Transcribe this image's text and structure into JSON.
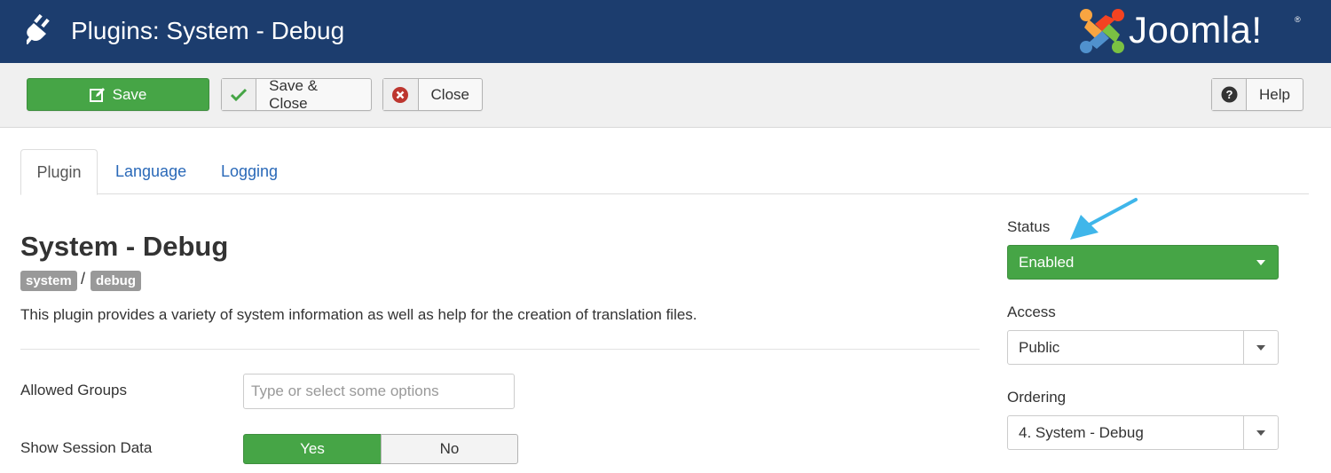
{
  "header": {
    "title": "Plugins: System - Debug",
    "logo_text": "Joomla!",
    "logo_mark": "®",
    "background": "#1c3d6e"
  },
  "toolbar": {
    "save_label": "Save",
    "save_close_label": "Save & Close",
    "close_label": "Close",
    "help_label": "Help",
    "save_color": "#46a546"
  },
  "tabs": [
    {
      "label": "Plugin",
      "active": true
    },
    {
      "label": "Language",
      "active": false
    },
    {
      "label": "Logging",
      "active": false
    }
  ],
  "plugin": {
    "title": "System - Debug",
    "badges": [
      "system",
      "debug"
    ],
    "separator": "/",
    "description": "This plugin provides a variety of system information as well as help for the creation of translation files."
  },
  "fields": {
    "allowed_groups": {
      "label": "Allowed Groups",
      "placeholder": "Type or select some options"
    },
    "show_session": {
      "label": "Show Session Data",
      "yes": "Yes",
      "no": "No",
      "selected": "Yes"
    }
  },
  "side": {
    "status": {
      "label": "Status",
      "value": "Enabled"
    },
    "access": {
      "label": "Access",
      "value": "Public"
    },
    "ordering": {
      "label": "Ordering",
      "value": "4. System - Debug"
    }
  },
  "icons": {
    "plugin": "plug-icon",
    "save": "edit-icon",
    "save_close": "checkmark-icon",
    "close": "cancel-circle-icon",
    "help": "question-circle-icon"
  },
  "annotation_color": "#3fb6ea"
}
